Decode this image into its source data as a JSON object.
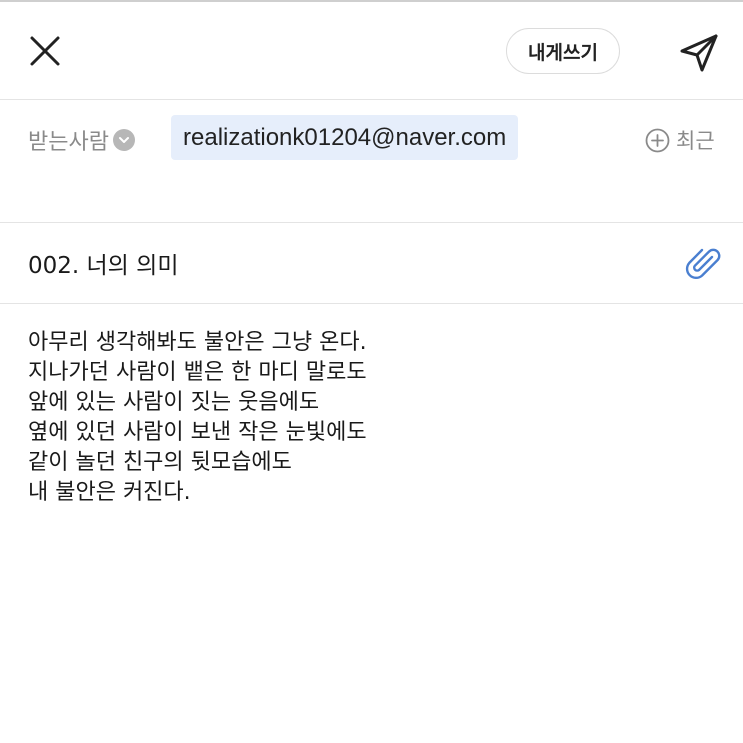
{
  "header": {
    "close_icon": "close-icon",
    "self_write_label": "내게쓰기",
    "send_icon": "send-icon"
  },
  "recipient": {
    "label": "받는사람",
    "expand_icon": "chevron-down-icon",
    "email": "realizationk01204@naver.com",
    "recent_icon": "plus-circle-icon",
    "recent_label": "최근"
  },
  "subject": {
    "value": "002. 너의 의미",
    "attach_icon": "paperclip-icon"
  },
  "body": {
    "lines": [
      "아무리 생각해봐도 불안은 그냥 온다.",
      "지나가던 사람이 뱉은 한 마디 말로도",
      "앞에 있는 사람이 짓는 웃음에도",
      "옆에 있던 사람이 보낸 작은 눈빛에도",
      "같이 놀던 친구의 뒷모습에도",
      "내 불안은 커진다."
    ]
  },
  "colors": {
    "chip_bg": "#e6eefb",
    "attach_blue": "#4a7fd0",
    "muted_gray": "#8a8a8a",
    "divider": "#e4e4e4"
  }
}
